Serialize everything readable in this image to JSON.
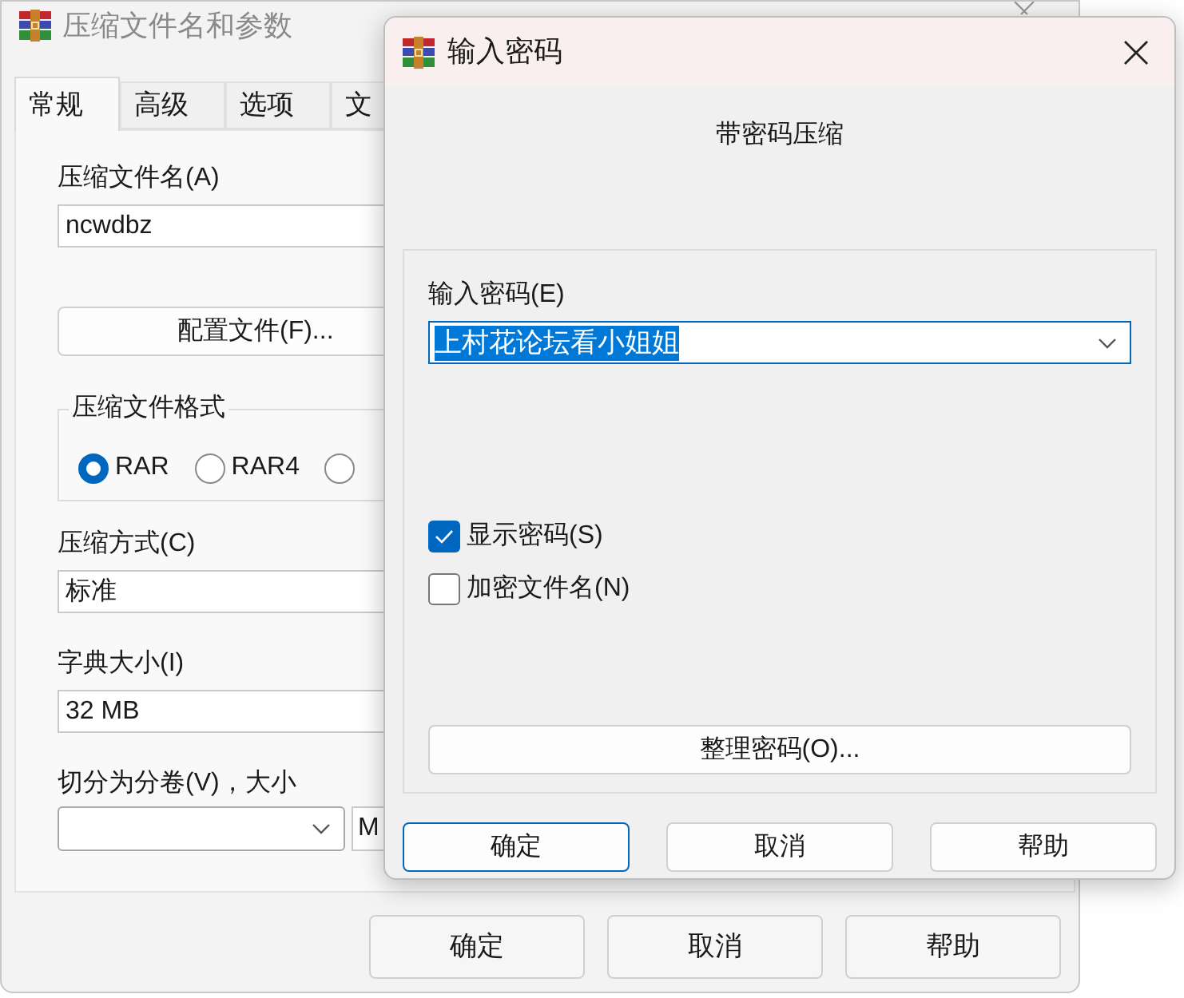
{
  "back_window": {
    "title": "压缩文件名和参数",
    "tabs": [
      {
        "label": "常规",
        "selected": true
      },
      {
        "label": "高级",
        "selected": false
      },
      {
        "label": "选项",
        "selected": false
      },
      {
        "label": "文",
        "selected": false
      }
    ],
    "archive_name": {
      "label": "压缩文件名(A)",
      "value": "ncwdbz"
    },
    "profiles_button": "配置文件(F)...",
    "format_group": {
      "title": "压缩文件格式",
      "options": [
        {
          "label": "RAR",
          "selected": true
        },
        {
          "label": "RAR4",
          "selected": false
        },
        {
          "selected": false
        }
      ]
    },
    "method": {
      "label": "压缩方式(C)",
      "value": "标准"
    },
    "dictionary": {
      "label": "字典大小(I)",
      "value": "32 MB"
    },
    "split": {
      "label": "切分为分卷(V)，大小",
      "unit": "M"
    },
    "buttons": [
      "确定",
      "取消",
      "帮助"
    ]
  },
  "dialog": {
    "title": "输入密码",
    "heading": "带密码压缩",
    "password": {
      "label": "输入密码(E)",
      "value": "上村花论坛看小姐姐",
      "text_selected": true
    },
    "checkboxes": [
      {
        "label": "显示密码(S)",
        "checked": true
      },
      {
        "label": "加密文件名(N)",
        "checked": false
      }
    ],
    "organize_button": "整理密码(O)...",
    "buttons": [
      {
        "label": "确定",
        "default": true
      },
      {
        "label": "取消",
        "default": false
      },
      {
        "label": "帮助",
        "default": false
      }
    ]
  }
}
